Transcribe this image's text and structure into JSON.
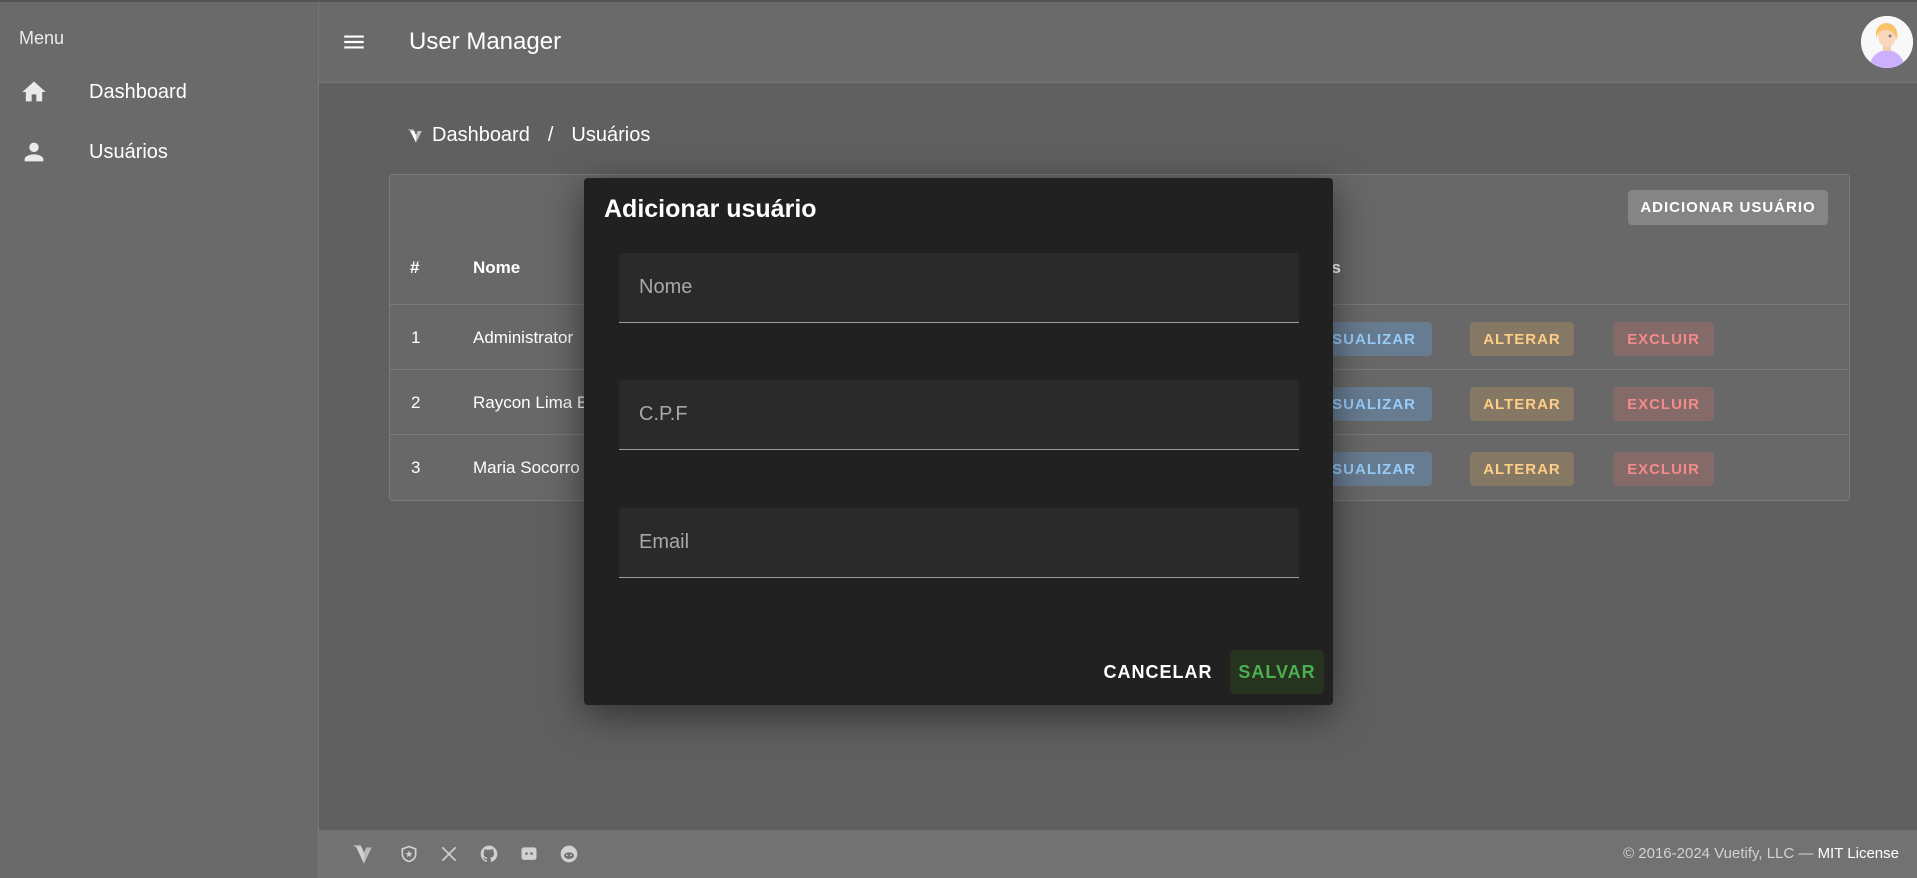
{
  "sidebar": {
    "title": "Menu",
    "items": [
      {
        "label": "Dashboard",
        "icon": "home-icon"
      },
      {
        "label": "Usuários",
        "icon": "person-icon"
      }
    ]
  },
  "appbar": {
    "title": "User Manager",
    "menu_icon": "hamburger-icon"
  },
  "breadcrumb": {
    "items": [
      "Dashboard",
      "Usuários"
    ],
    "separator": "/"
  },
  "table": {
    "add_button": "ADICIONAR USUÁRIO",
    "headers": [
      "#",
      "Nome",
      "es"
    ],
    "rows": [
      {
        "id": "1",
        "name": "Administrator",
        "view": "SUALIZAR",
        "edit": "ALTERAR",
        "delete": "EXCLUIR"
      },
      {
        "id": "2",
        "name": "Raycon Lima E",
        "view": "SUALIZAR",
        "edit": "ALTERAR",
        "delete": "EXCLUIR"
      },
      {
        "id": "3",
        "name": "Maria Socorro",
        "view": "SUALIZAR",
        "edit": "ALTERAR",
        "delete": "EXCLUIR"
      }
    ]
  },
  "dialog": {
    "title": "Adicionar usuário",
    "fields": [
      {
        "placeholder": "Nome",
        "value": ""
      },
      {
        "placeholder": "C.P.F",
        "value": ""
      },
      {
        "placeholder": "Email",
        "value": ""
      }
    ],
    "cancel_label": "CANCELAR",
    "save_label": "SALVAR"
  },
  "footer": {
    "copyright": "© 2016-2024 Vuetify, LLC —",
    "license_link": "MIT License",
    "icons": [
      "vuetify-logo-icon",
      "shield-icon",
      "x-twitter-icon",
      "github-icon",
      "discord-icon",
      "reddit-icon"
    ]
  },
  "colors": {
    "view": "#64b5f6",
    "edit": "#ffb74d",
    "delete": "#ef5350",
    "save": "#4caf50"
  }
}
